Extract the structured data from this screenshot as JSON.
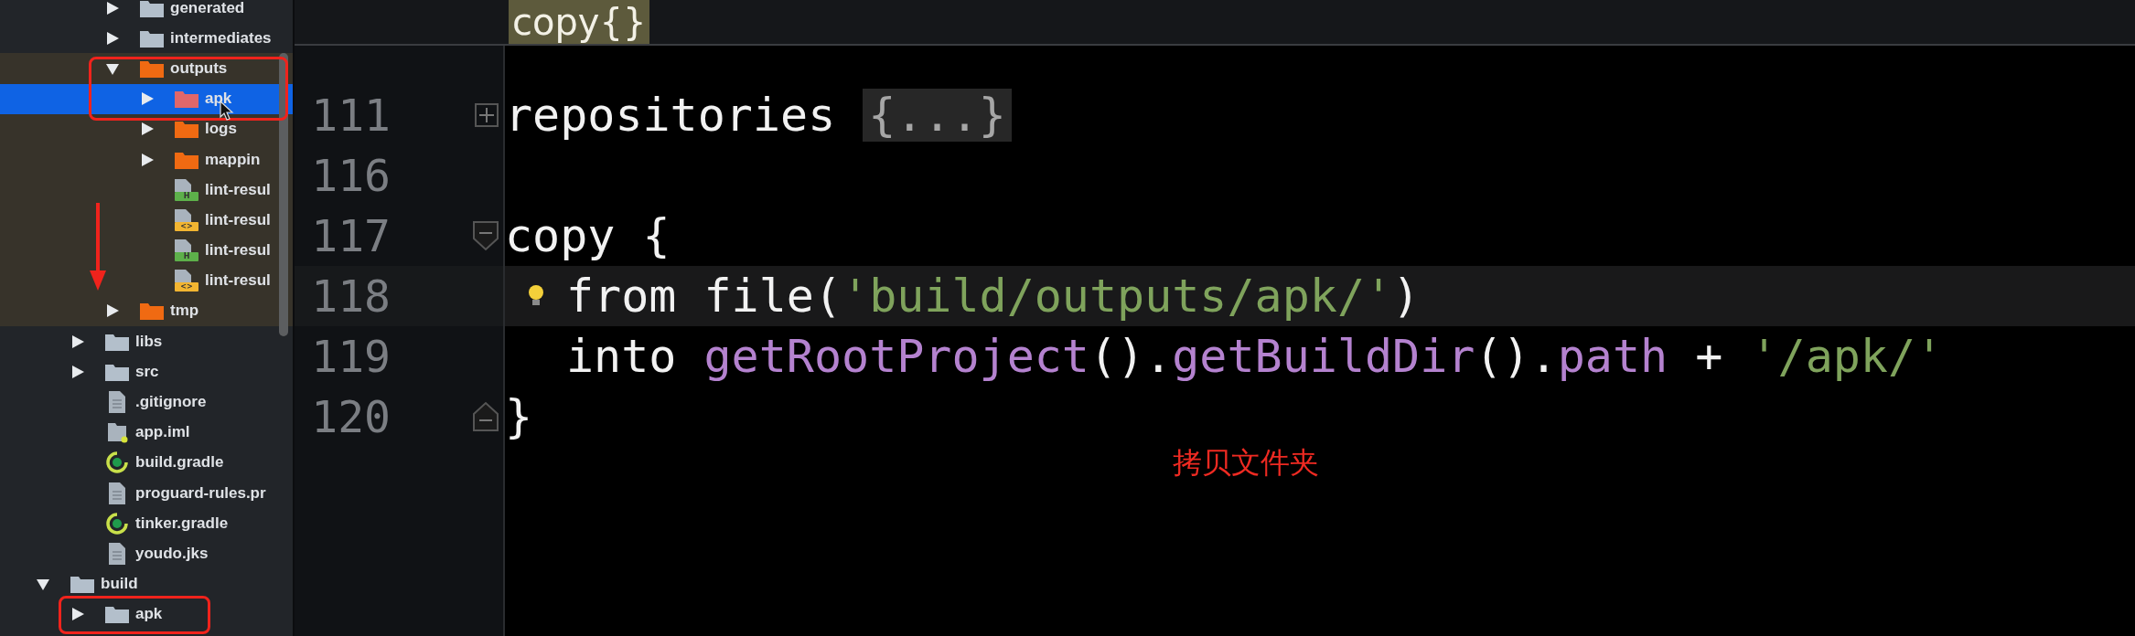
{
  "tree": [
    {
      "children": [
        {
          "children": [
            {
              "label": "generated",
              "kind": "folder",
              "color": "#b3bfcb",
              "expanded": false,
              "selected": false,
              "highlighted": false
            },
            {
              "label": "intermediates",
              "kind": "folder",
              "color": "#b3bfcb",
              "expanded": false,
              "selected": false,
              "highlighted": false
            },
            {
              "label": "outputs",
              "kind": "folder",
              "color": "#f06a12",
              "expanded": true,
              "selected": false,
              "highlighted": true,
              "children": [
                {
                  "label": "apk",
                  "kind": "folder",
                  "color": "#e0676a",
                  "expanded": false,
                  "selected": true,
                  "highlighted": true
                },
                {
                  "label": "logs",
                  "kind": "folder",
                  "color": "#f06a12",
                  "expanded": false,
                  "selected": false,
                  "highlighted": true
                },
                {
                  "label": "mappin",
                  "kind": "folder",
                  "color": "#f06a12",
                  "expanded": false,
                  "selected": false,
                  "highlighted": true
                },
                {
                  "label": "lint-resul",
                  "kind": "lint",
                  "badge": {
                    "text": "H",
                    "color": "#5db04a"
                  },
                  "selected": false,
                  "highlighted": true
                },
                {
                  "label": "lint-resul",
                  "kind": "lint",
                  "badge": {
                    "text": "<>",
                    "color": "#f2b531"
                  },
                  "selected": false,
                  "highlighted": true
                },
                {
                  "label": "lint-resul",
                  "kind": "lint",
                  "badge": {
                    "text": "H",
                    "color": "#5db04a"
                  },
                  "selected": false,
                  "highlighted": true
                },
                {
                  "label": "lint-resul",
                  "kind": "lint",
                  "badge": {
                    "text": "<>",
                    "color": "#f2b531"
                  },
                  "selected": false,
                  "highlighted": true
                }
              ]
            },
            {
              "label": "tmp",
              "kind": "folder",
              "color": "#f06a12",
              "expanded": false,
              "selected": false,
              "highlighted": true
            }
          ]
        },
        {
          "label": "libs",
          "kind": "folder",
          "color": "#b3bfcb",
          "expanded": false,
          "selected": false,
          "highlighted": false
        },
        {
          "label": "src",
          "kind": "folder",
          "color": "#b3bfcb",
          "expanded": false,
          "selected": false,
          "highlighted": false
        },
        {
          "label": ".gitignore",
          "kind": "file",
          "selected": false,
          "highlighted": false
        },
        {
          "label": "app.iml",
          "kind": "iml",
          "selected": false,
          "highlighted": false
        },
        {
          "label": "build.gradle",
          "kind": "gradle",
          "selected": false,
          "highlighted": false
        },
        {
          "label": "proguard-rules.pr",
          "kind": "file",
          "selected": false,
          "highlighted": false
        },
        {
          "label": "tinker.gradle",
          "kind": "gradle",
          "selected": false,
          "highlighted": false
        },
        {
          "label": "youdo.jks",
          "kind": "file",
          "selected": false,
          "highlighted": false
        }
      ]
    },
    {
      "label": "build",
      "kind": "folder",
      "color": "#b3bfcb",
      "expanded": true,
      "selected": false,
      "highlighted": false,
      "children": [
        {
          "label": "apk",
          "kind": "folder",
          "color": "#b3bfcb",
          "expanded": false,
          "selected": false,
          "highlighted": false
        }
      ]
    }
  ],
  "editor": {
    "breadcrumb": "copy{}",
    "lines": [
      {
        "number": "111",
        "collapsed": true,
        "current": false,
        "tokens": [
          {
            "kind": "plain",
            "text": "repositories"
          },
          {
            "kind": "folded",
            "text": "{...}"
          }
        ]
      },
      {
        "number": "116",
        "current": false
      },
      {
        "number": "117",
        "expanded": true,
        "current": false,
        "tokens": [
          {
            "kind": "plain",
            "text": "copy {"
          }
        ],
        "children": [
          {
            "number": "118",
            "current": true,
            "bulb": true,
            "tokens": [
              {
                "kind": "plain",
                "text": "from file("
              },
              {
                "kind": "string",
                "text": "'build/outputs/apk/'"
              },
              {
                "kind": "plain",
                "text": ")"
              }
            ]
          },
          {
            "number": "119",
            "current": false,
            "tokens": [
              {
                "kind": "plain",
                "text": "into "
              },
              {
                "kind": "method",
                "text": "getRootProject"
              },
              {
                "kind": "plain",
                "text": "()."
              },
              {
                "kind": "method",
                "text": "getBuildDir"
              },
              {
                "kind": "plain",
                "text": "()."
              },
              {
                "kind": "method",
                "text": "path"
              },
              {
                "kind": "plain",
                "text": " + "
              },
              {
                "kind": "string",
                "text": "'/apk/'"
              }
            ]
          }
        ]
      },
      {
        "number": "120",
        "block_end": true,
        "current": false,
        "tokens": [
          {
            "kind": "plain",
            "text": "}"
          }
        ]
      }
    ]
  },
  "annotation": {
    "text": "拷贝文件夹"
  }
}
